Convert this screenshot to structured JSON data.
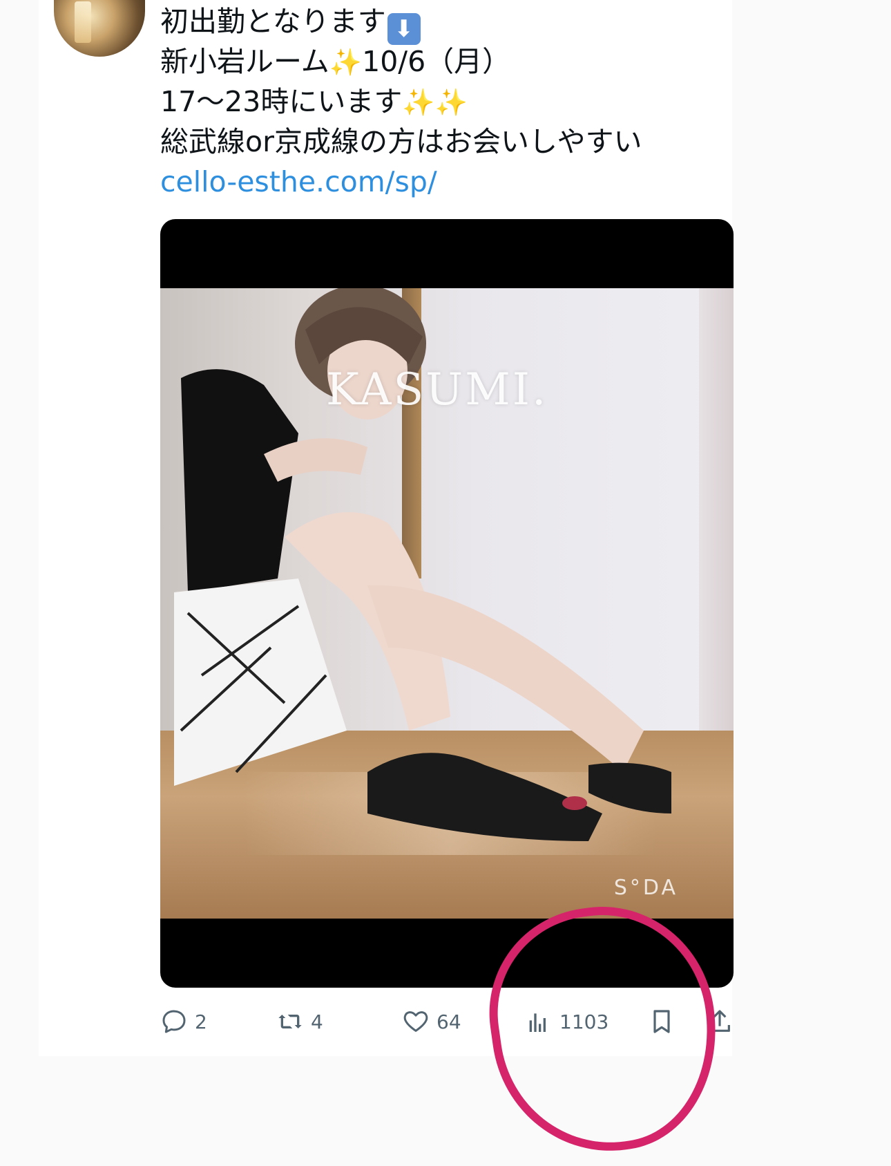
{
  "tweet": {
    "lines": [
      "初出勤となります",
      "新小岩ルーム",
      "10/6（月）",
      "17〜23時にいます",
      "総武線or京成線の方はお会いしやすい"
    ],
    "link": "cello-esthe.com/sp/",
    "emoji": {
      "down_arrow": "⬇",
      "sparkles": "✨"
    }
  },
  "media": {
    "watermark_name": "KASUMI.",
    "watermark_app": "S°DA"
  },
  "actions": {
    "replies": "2",
    "retweets": "4",
    "likes": "64",
    "views": "1103"
  },
  "annotation": {
    "circle_color": "#d6246a"
  }
}
